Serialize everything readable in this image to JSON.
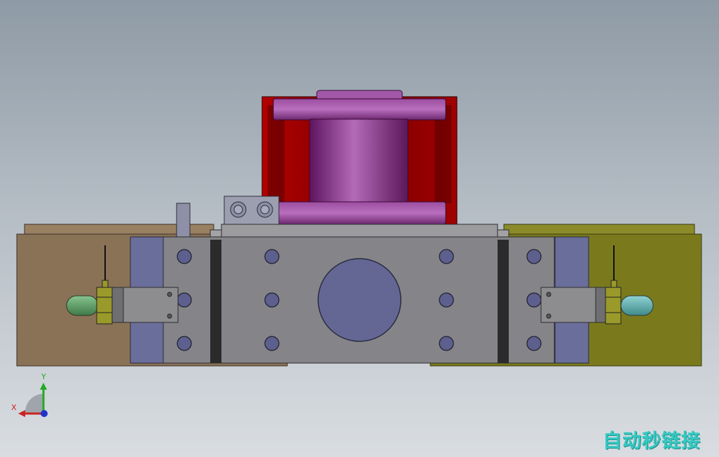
{
  "viewport": {
    "background_top": "#8e9aa5",
    "background_bottom": "#d9dde1"
  },
  "model": {
    "description_icon": "cad-3d-assembly",
    "colors": {
      "left_plate": "#8a7257",
      "right_plate": "#7a7a1d",
      "side_blue": "#6a6e9a",
      "body_grey": "#858589",
      "dark_strip": "#2b2b2b",
      "flange_purple": "#8e3d90",
      "drum_red": "#8a0000",
      "bolt_blue": "#5d5f8e",
      "left_nozzle": "#5f9a69",
      "right_nozzle": "#5fa8a8",
      "yellow_block": "#9a9a2a"
    }
  },
  "triad": {
    "x_label": "X",
    "y_label": "Y",
    "x_color": "#cc2222",
    "y_color": "#22aa22",
    "z_color": "#2233cc"
  },
  "watermark": {
    "text": "自动秒链接",
    "color": "#35c9c3"
  }
}
